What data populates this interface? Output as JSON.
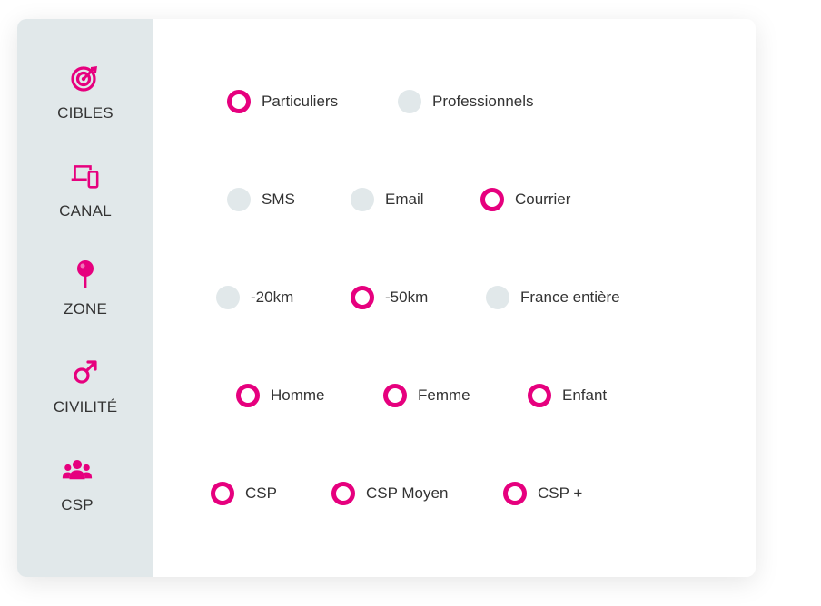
{
  "colors": {
    "accent": "#e6007e",
    "sidebar_bg": "#e1e8ea",
    "off_radio": "#e1e8ea"
  },
  "sidebar": {
    "items": [
      {
        "label": "CIBLES",
        "icon": "target-icon"
      },
      {
        "label": "CANAL",
        "icon": "devices-icon"
      },
      {
        "label": "ZONE",
        "icon": "pin-icon"
      },
      {
        "label": "CIVILITÉ",
        "icon": "male-symbol-icon"
      },
      {
        "label": "CSP",
        "icon": "users-group-icon"
      }
    ]
  },
  "rows": [
    {
      "options": [
        {
          "label": "Particuliers",
          "selected": true
        },
        {
          "label": "Professionnels",
          "selected": false
        }
      ]
    },
    {
      "options": [
        {
          "label": "SMS",
          "selected": false
        },
        {
          "label": "Email",
          "selected": false
        },
        {
          "label": "Courrier",
          "selected": true
        }
      ]
    },
    {
      "options": [
        {
          "label": "-20km",
          "selected": false
        },
        {
          "label": "-50km",
          "selected": true
        },
        {
          "label": "France entière",
          "selected": false
        }
      ]
    },
    {
      "options": [
        {
          "label": "Homme",
          "selected": true
        },
        {
          "label": "Femme",
          "selected": true
        },
        {
          "label": "Enfant",
          "selected": true
        }
      ]
    },
    {
      "options": [
        {
          "label": "CSP",
          "selected": true
        },
        {
          "label": "CSP Moyen",
          "selected": true
        },
        {
          "label": "CSP +",
          "selected": true
        }
      ]
    }
  ]
}
